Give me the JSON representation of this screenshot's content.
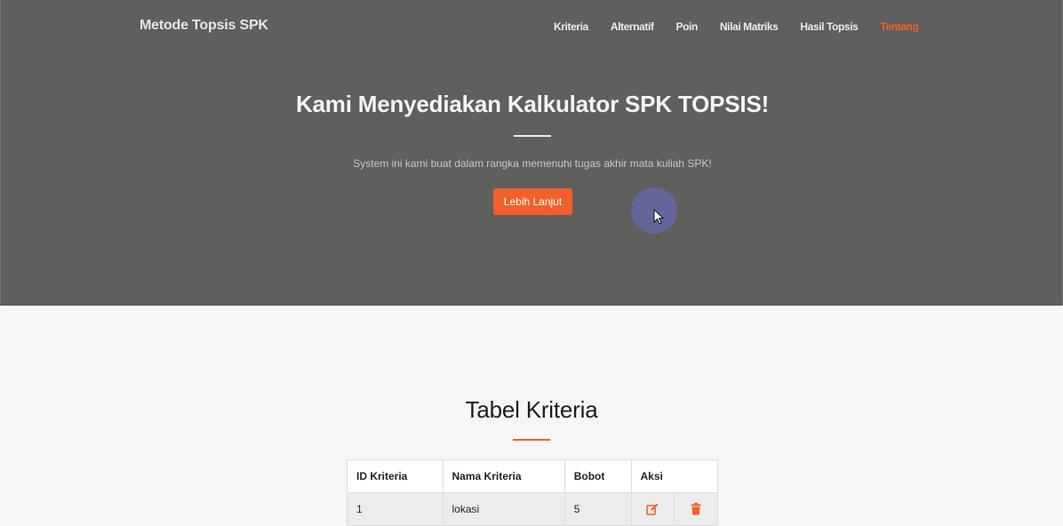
{
  "navbar": {
    "brand": "Metode Topsis SPK",
    "links": [
      {
        "label": "Kriteria"
      },
      {
        "label": "Alternatif"
      },
      {
        "label": "Poin"
      },
      {
        "label": "Nilai Matriks"
      },
      {
        "label": "Hasil Topsis"
      },
      {
        "label": "Tentang",
        "active": true
      }
    ]
  },
  "hero": {
    "title": "Kami Menyediakan Kalkulator SPK TOPSIS!",
    "subtitle": "System ini kami buat dalam rangka memenuhi tugas akhir mata kuliah SPK!",
    "cta_label": "Lebih Lanjut"
  },
  "kriteria_section": {
    "title": "Tabel Kriteria",
    "columns": [
      "ID Kriteria",
      "Nama Kriteria",
      "Bobot",
      "Aksi"
    ],
    "rows": [
      {
        "id": "1",
        "nama": "lokasi",
        "bobot": "5",
        "actions": [
          "edit-icon",
          "trash-icon"
        ]
      }
    ]
  },
  "colors": {
    "accent": "#f0602a",
    "hero_bg": "#5f5f5d",
    "page_bg": "#f6f6f4",
    "cursor_halo": "#64669a"
  }
}
